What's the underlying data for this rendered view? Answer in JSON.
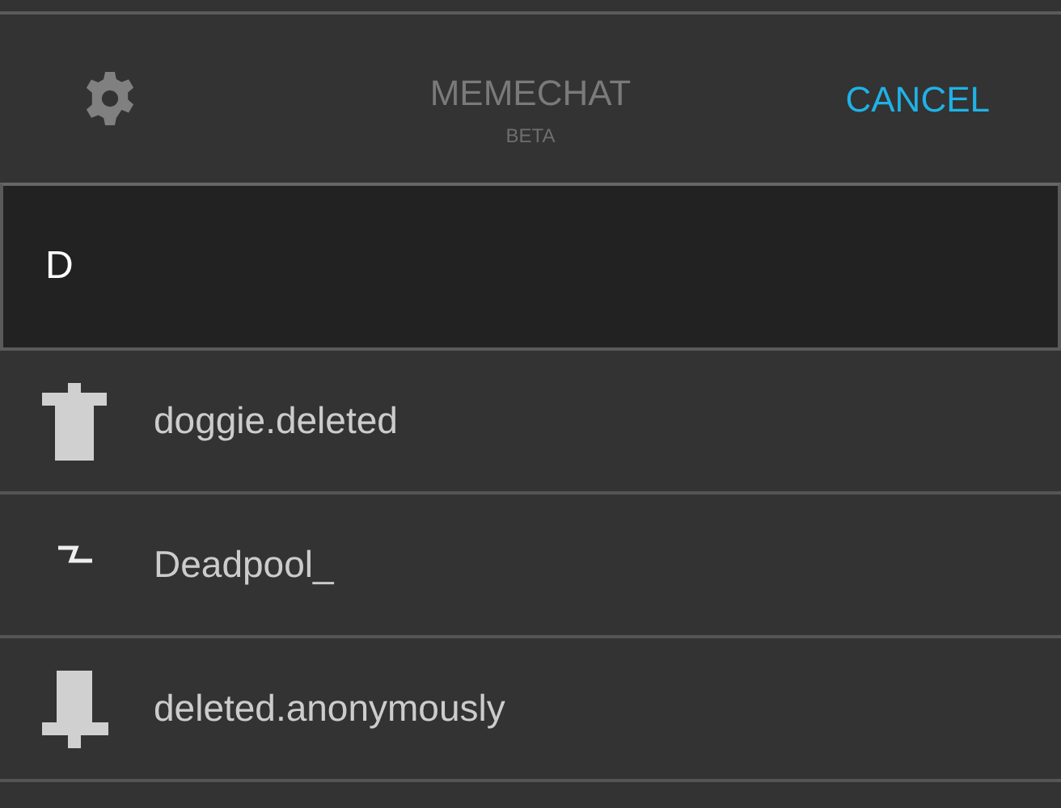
{
  "header": {
    "title": "MEMECHAT",
    "subtitle": "BETA",
    "cancel": "CANCEL"
  },
  "search": {
    "value": "D"
  },
  "users": [
    {
      "name": "doggie.deleted",
      "kind": "shirt"
    },
    {
      "name": "Deadpool_",
      "kind": "bolt"
    },
    {
      "name": "deleted.anonymously",
      "kind": "pedestal"
    }
  ]
}
